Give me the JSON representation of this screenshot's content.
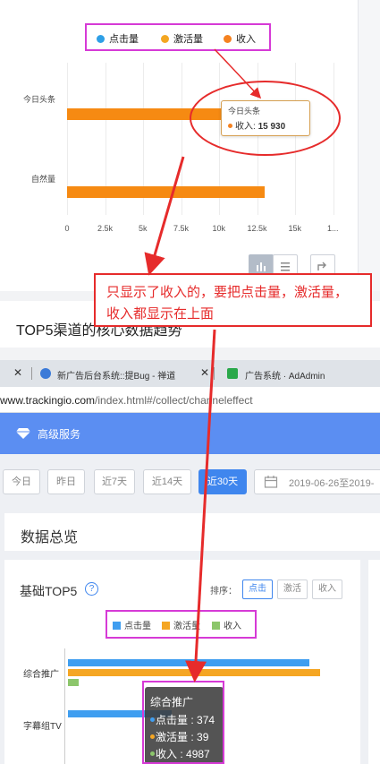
{
  "top_chart": {
    "legend": [
      "点击量",
      "激活量",
      "收入"
    ],
    "legend_colors": [
      "#2e9fe6",
      "#f4a722",
      "#f58220"
    ],
    "categories": [
      "今日头条",
      "自然量"
    ],
    "x_ticks": [
      "0",
      "2.5k",
      "5k",
      "7.5k",
      "10k",
      "12.5k",
      "15k",
      "1..."
    ],
    "tooltip": {
      "title": "今日头条",
      "label": "收入",
      "value": "15 930"
    }
  },
  "chart_data": [
    {
      "type": "bar",
      "orientation": "horizontal",
      "categories": [
        "今日头条",
        "自然量"
      ],
      "series": [
        {
          "name": "收入",
          "values": [
            15930,
            13000
          ]
        }
      ],
      "xlim": [
        0,
        17500
      ]
    },
    {
      "type": "bar",
      "orientation": "horizontal",
      "categories": [
        "综合推广",
        "字幕组TV"
      ],
      "series": [
        {
          "name": "点击量",
          "values": [
            374,
            160
          ]
        },
        {
          "name": "激活量",
          "values": [
            39,
            null
          ]
        },
        {
          "name": "收入",
          "values": [
            4987,
            null
          ]
        }
      ]
    }
  ],
  "annotation": "只显示了收入的，要把点击量，激活量，收入都显示在上面",
  "section_title": "TOP5渠道的核心数据趋势",
  "browser": {
    "tab1": "新广告后台系统::提Bug - 禅道",
    "tab2": "广告系统 · AdAdmin",
    "url_prefix": "www.trackingio.com",
    "url_path": "/index.html#/collect/channeleffect"
  },
  "app": {
    "header_title": "高级服务",
    "date_buttons": [
      "今日",
      "昨日",
      "近7天",
      "近14天",
      "近30天"
    ],
    "active_date": "近30天",
    "date_range": "2019-06-26至2019-",
    "overview_title": "数据总览",
    "top5_title": "基础TOP5",
    "sort_label": "排序：",
    "sort_options": [
      "点击",
      "激活",
      "收入"
    ],
    "legend2": [
      "点击量",
      "激活量",
      "收入"
    ],
    "legend2_colors": [
      "#3f9ef0",
      "#f5a623",
      "#8cc66b"
    ],
    "categories": [
      "综合推广",
      "字幕组TV"
    ],
    "tooltip2": {
      "title": "综合推广",
      "lines": [
        {
          "label": "点击量",
          "value": "374"
        },
        {
          "label": "激活量",
          "value": "39"
        },
        {
          "label": "收入",
          "value": "4987"
        }
      ]
    }
  }
}
